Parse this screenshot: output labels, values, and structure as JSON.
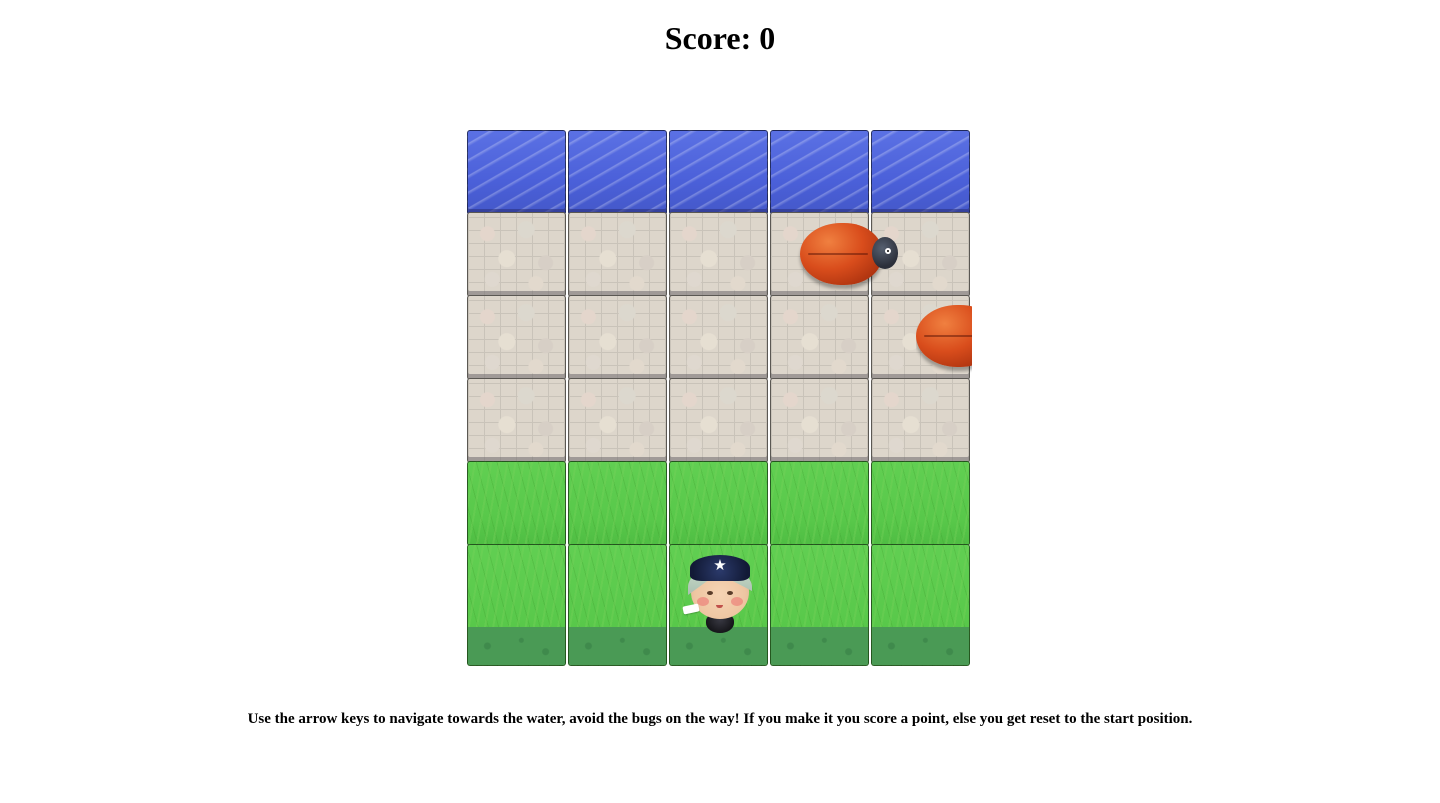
{
  "score": {
    "text": "Score: 0",
    "value": 0
  },
  "board": {
    "columns": 5,
    "rows": [
      "water",
      "stone",
      "stone",
      "stone",
      "grass",
      "grass"
    ],
    "colors": {
      "water": "#4b60d9",
      "stone": "#ddd6cb",
      "grass": "#58c84a"
    }
  },
  "enemies": [
    {
      "name": "bug",
      "icon": "ladybug-icon",
      "row": 1,
      "col": 3.3
    },
    {
      "name": "bug",
      "icon": "ladybug-icon",
      "row": 2,
      "col": 4.45
    }
  ],
  "player": {
    "icon": "boy-character-icon",
    "row": 5,
    "col": 2
  },
  "instructions": "Use the arrow keys to navigate towards the water, avoid the bugs on the way! If you make it you score a point, else you get reset to the start position."
}
